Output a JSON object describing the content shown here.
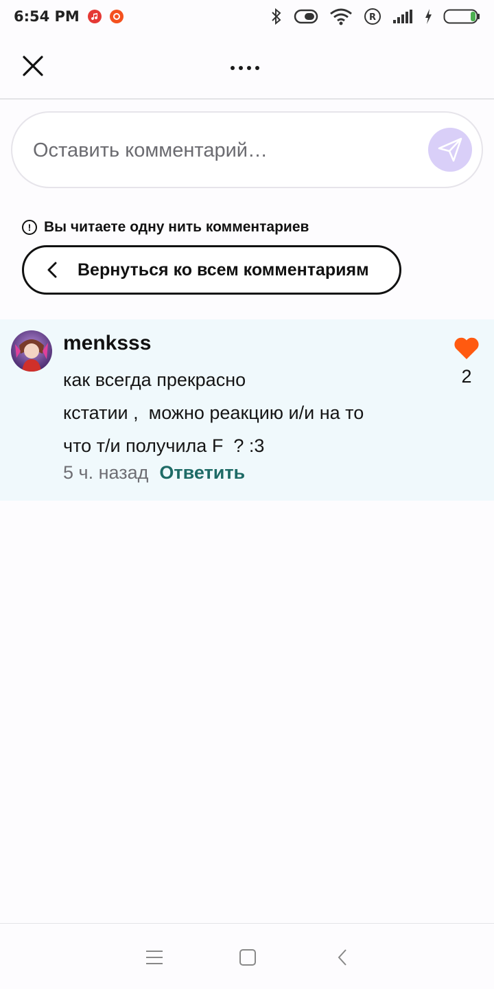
{
  "status_bar": {
    "time": "6:54 PM",
    "notifications": [
      {
        "icon": "music-icon",
        "color": "#e53935"
      },
      {
        "icon": "app-icon",
        "color": "#f4511e"
      }
    ],
    "icons": [
      "bluetooth-icon",
      "vibrate-icon",
      "wifi-icon",
      "roaming-icon",
      "signal-icon",
      "charging-icon",
      "battery-icon"
    ],
    "battery_color": "#4caf50"
  },
  "header": {
    "close_icon": "close-icon",
    "more_icon": "more-icon"
  },
  "comment_input": {
    "placeholder": "Оставить комментарий…",
    "send_icon": "send-icon",
    "send_color": "#d9cff8"
  },
  "thread": {
    "notice": "Вы читаете одну нить комментариев",
    "back_label": "Вернуться ко всем комментариям"
  },
  "comment": {
    "username": "menksss",
    "lines": [
      "как всегда прекрасно",
      "кстатии ,  можно реакцию и/и на то",
      "что т/и получила F  ? :3"
    ],
    "timestamp": "5 ч. назад",
    "reply_label": "Ответить",
    "likes": "2",
    "heart_color": "#ff5a10",
    "background": "#f0f9fc"
  },
  "nav_bar": {
    "icons": [
      "menu-icon",
      "home-icon",
      "back-icon"
    ]
  }
}
